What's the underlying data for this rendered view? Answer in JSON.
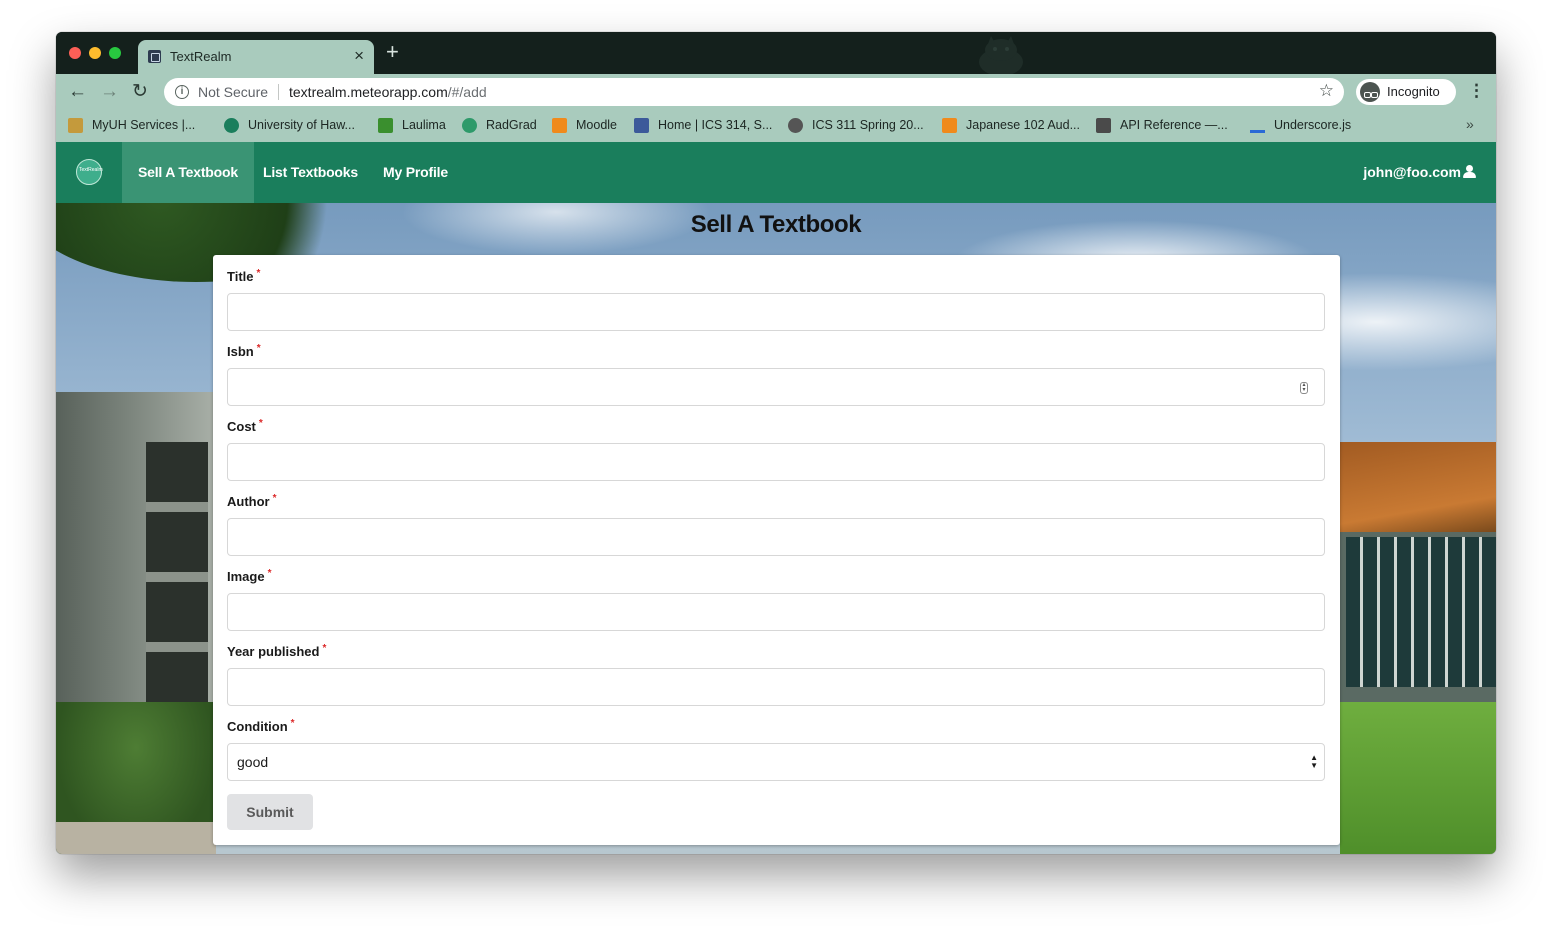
{
  "browser": {
    "tab": {
      "title": "TextRealm",
      "close_glyph": "×",
      "favicon": "textrealm-favicon-icon"
    },
    "new_tab_glyph": "+",
    "toolbar": {
      "back_glyph": "←",
      "forward_glyph": "→",
      "reload_glyph": "↻",
      "info_glyph": "i",
      "security_text": "Not Secure",
      "url_host": "textrealm.meteorapp.com",
      "url_path": "/#/add",
      "bookmark_star_glyph": "☆",
      "profile_label": "Incognito",
      "menu_glyph": "⋮"
    },
    "bookmarks": [
      {
        "label": "MyUH Services |...",
        "icon_color": "#c49a3c"
      },
      {
        "label": "University of Haw...",
        "icon_color": "#1a7e5c"
      },
      {
        "label": "Laulima",
        "icon_color": "#3a8f2e"
      },
      {
        "label": "RadGrad",
        "icon_color": "#2e9a6a"
      },
      {
        "label": "Moodle",
        "icon_color": "#f08a1c"
      },
      {
        "label": "Home | ICS 314, S...",
        "icon_color": "#3c5a9a"
      },
      {
        "label": "ICS 311 Spring 20...",
        "icon_color": "#555555"
      },
      {
        "label": "Japanese 102 Aud...",
        "icon_color": "#f08a1c"
      },
      {
        "label": "API Reference —...",
        "icon_color": "#4a4a4a"
      },
      {
        "label": "Underscore.js",
        "icon_color": "#2a6ad6"
      }
    ],
    "bookmarks_more_glyph": "»"
  },
  "app": {
    "logo_text": "TextRealm",
    "nav": [
      {
        "label": "Sell A Textbook",
        "active": true
      },
      {
        "label": "List Textbooks",
        "active": false
      },
      {
        "label": "My Profile",
        "active": false
      }
    ],
    "user_email": "john@foo.com",
    "page_title": "Sell A Textbook",
    "form": {
      "required_marker": "*",
      "fields": [
        {
          "label": "Title",
          "value": ""
        },
        {
          "label": "Isbn",
          "value": ""
        },
        {
          "label": "Cost",
          "value": ""
        },
        {
          "label": "Author",
          "value": ""
        },
        {
          "label": "Image",
          "value": ""
        },
        {
          "label": "Year published",
          "value": ""
        }
      ],
      "condition": {
        "label": "Condition",
        "selected": "good"
      },
      "submit_label": "Submit"
    }
  }
}
